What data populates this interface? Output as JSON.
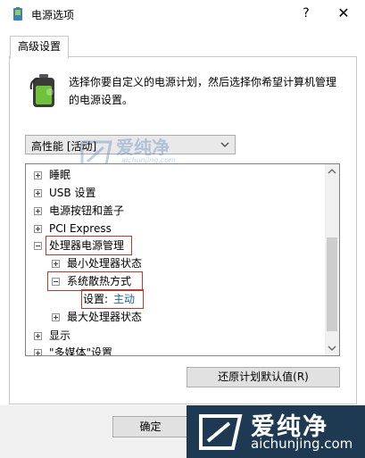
{
  "window": {
    "title": "电源选项",
    "help_label": "?",
    "close_label": "✕"
  },
  "tab": {
    "label": "高级设置"
  },
  "description": "选择你要自定义的电源计划，然后选择你希望计算机管理的电源设置。",
  "plan_select": {
    "value": "高性能 [活动]"
  },
  "tree": {
    "items": [
      {
        "label": "睡眠"
      },
      {
        "label": "USB 设置"
      },
      {
        "label": "电源按钮和盖子"
      },
      {
        "label": "PCI Express"
      },
      {
        "label": "处理器电源管理"
      },
      {
        "label": "最小处理器状态"
      },
      {
        "label": "系统散热方式"
      },
      {
        "label": "设置:",
        "value": "主动"
      },
      {
        "label": "最大处理器状态"
      },
      {
        "label": "显示"
      },
      {
        "label": "\"多媒体\"设置"
      }
    ]
  },
  "buttons": {
    "restore": "还原计划默认值(R)",
    "ok": "确定"
  },
  "watermark": {
    "text": "爱纯净",
    "url": "aichunjing.com"
  }
}
